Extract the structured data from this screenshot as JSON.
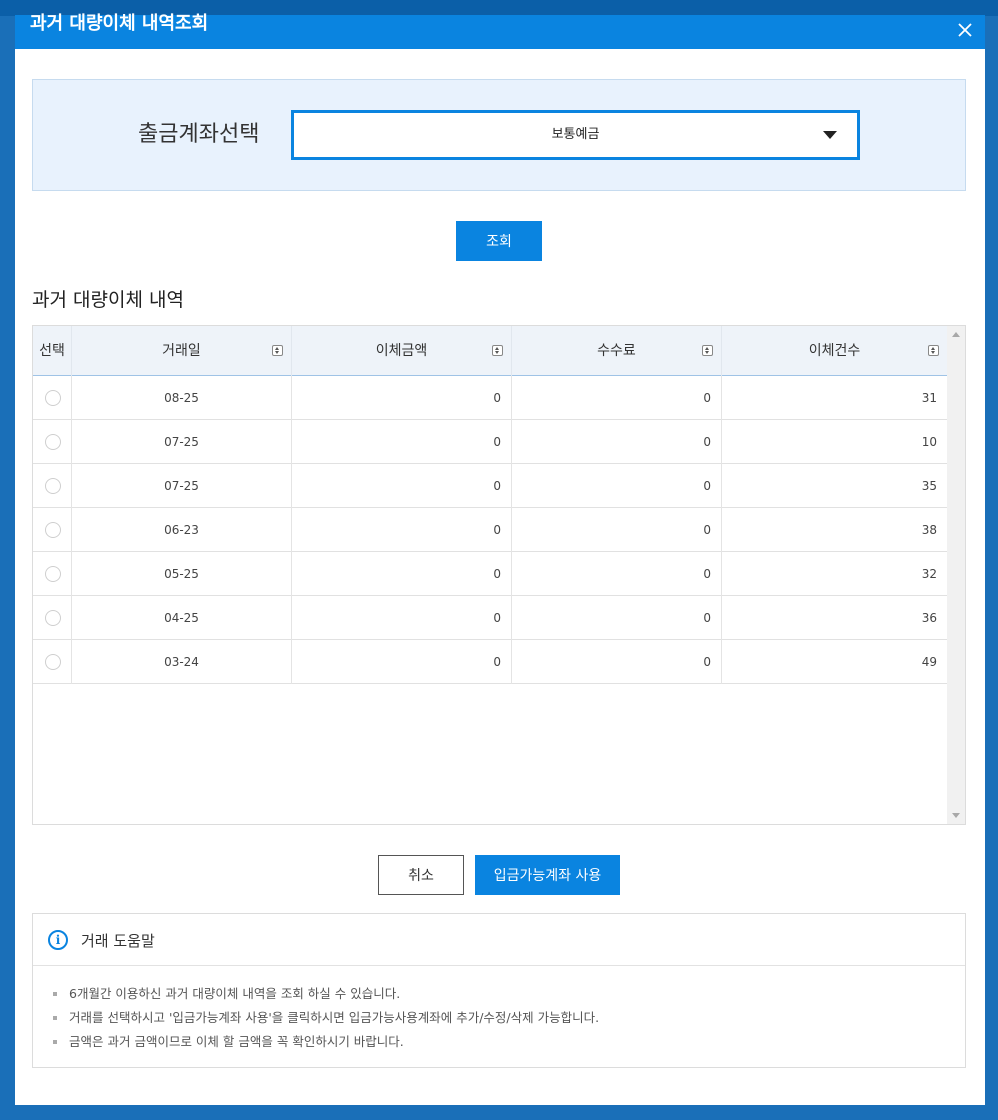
{
  "dialog": {
    "title": "과거 대량이체 내역조회"
  },
  "account": {
    "label": "출금계좌선택",
    "selected": "보통예금"
  },
  "search_button": "조회",
  "section_title": "과거 대량이체 내역",
  "table": {
    "headers": {
      "select": "선택",
      "date": "거래일",
      "amount": "이체금액",
      "fee": "수수료",
      "count": "이체건수"
    },
    "rows": [
      {
        "date": "08-25",
        "amount": "0",
        "fee": "0",
        "count": "31"
      },
      {
        "date": "07-25",
        "amount": "0",
        "fee": "0",
        "count": "10"
      },
      {
        "date": "07-25",
        "amount": "0",
        "fee": "0",
        "count": "35"
      },
      {
        "date": "06-23",
        "amount": "0",
        "fee": "0",
        "count": "38"
      },
      {
        "date": "05-25",
        "amount": "0",
        "fee": "0",
        "count": "32"
      },
      {
        "date": "04-25",
        "amount": "0",
        "fee": "0",
        "count": "36"
      },
      {
        "date": "03-24",
        "amount": "0",
        "fee": "0",
        "count": "49"
      }
    ]
  },
  "buttons": {
    "cancel": "취소",
    "use_account": "입금가능계좌 사용"
  },
  "help": {
    "title": "거래 도움말",
    "items": [
      "6개월간 이용하신 과거 대량이체 내역을 조회 하실 수 있습니다.",
      "거래를 선택하시고 '입금가능계좌 사용'을 클릭하시면 입금가능사용계좌에 추가/수정/삭제 가능합니다.",
      "금액은 과거 금액이므로 이체 할 금액을 꼭 확인하시기 바랍니다."
    ]
  },
  "colors": {
    "primary": "#0a84e0",
    "backdrop": "#1a6fb8",
    "account_box_bg": "#e8f2fd"
  }
}
